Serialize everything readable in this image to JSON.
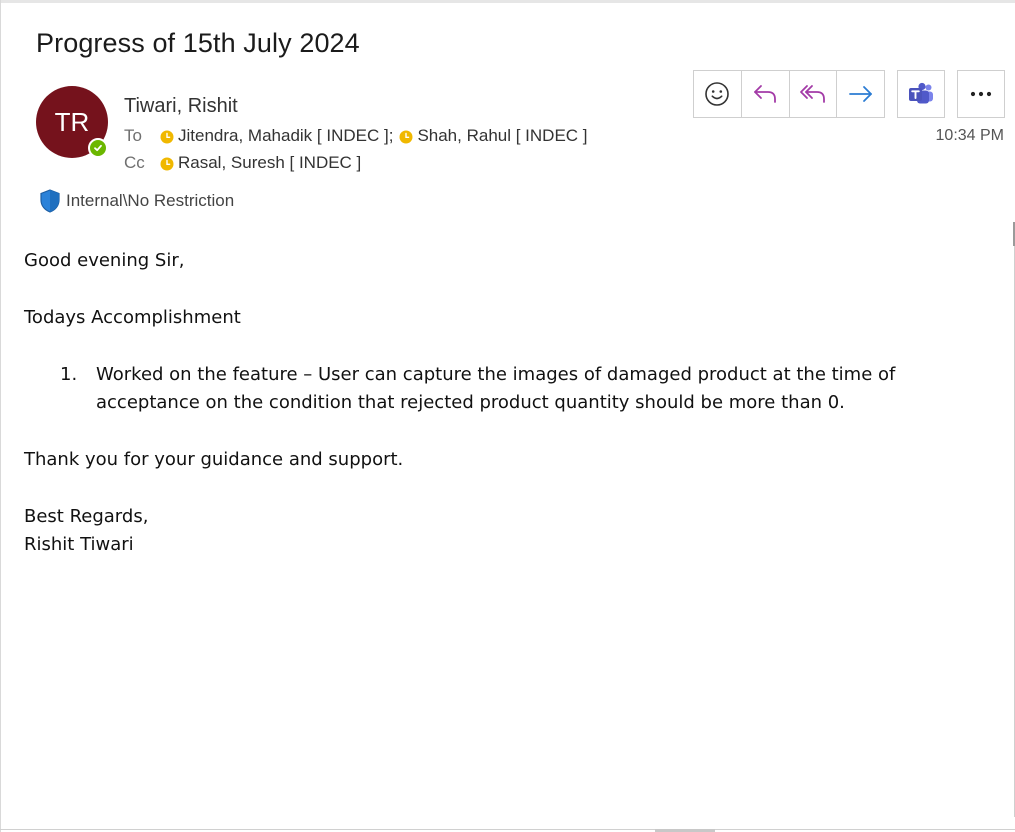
{
  "email": {
    "subject": "Progress of 15th July 2024",
    "avatar_initials": "TR",
    "sender": "Tiwari, Rishit",
    "to_label": "To",
    "to_recipients": [
      "Jitendra, Mahadik [ INDEC ]",
      "Shah, Rahul [ INDEC ]"
    ],
    "to_separator": ";",
    "cc_label": "Cc",
    "cc_recipients": [
      "Rasal, Suresh [ INDEC ]"
    ],
    "time": "10:34 PM",
    "sensitivity": "Internal\\No Restriction"
  },
  "toolbar": {
    "icons": [
      "emoji-icon",
      "reply-icon",
      "reply-all-icon",
      "forward-icon",
      "teams-icon",
      "more-icon"
    ]
  },
  "colors": {
    "avatar_bg": "#75121c",
    "presence_available": "#6bb700",
    "reply_purple": "#a33ba7",
    "forward_blue": "#2b7cd3",
    "teams_purple": "#5059c9",
    "shield_blue": "#2b82d9",
    "clock_yellow": "#f0b800"
  },
  "body": {
    "greeting": "Good evening Sir,",
    "heading": "Todays Accomplishment",
    "items": [
      {
        "number": "1.",
        "line1": "Worked on the feature – User can capture the images of damaged product at the time of",
        "line2": "acceptance on the condition that rejected product quantity should be more than 0."
      }
    ],
    "thanks": "Thank you for your guidance and support.",
    "closing": "Best Regards,",
    "signature": "Rishit Tiwari"
  }
}
